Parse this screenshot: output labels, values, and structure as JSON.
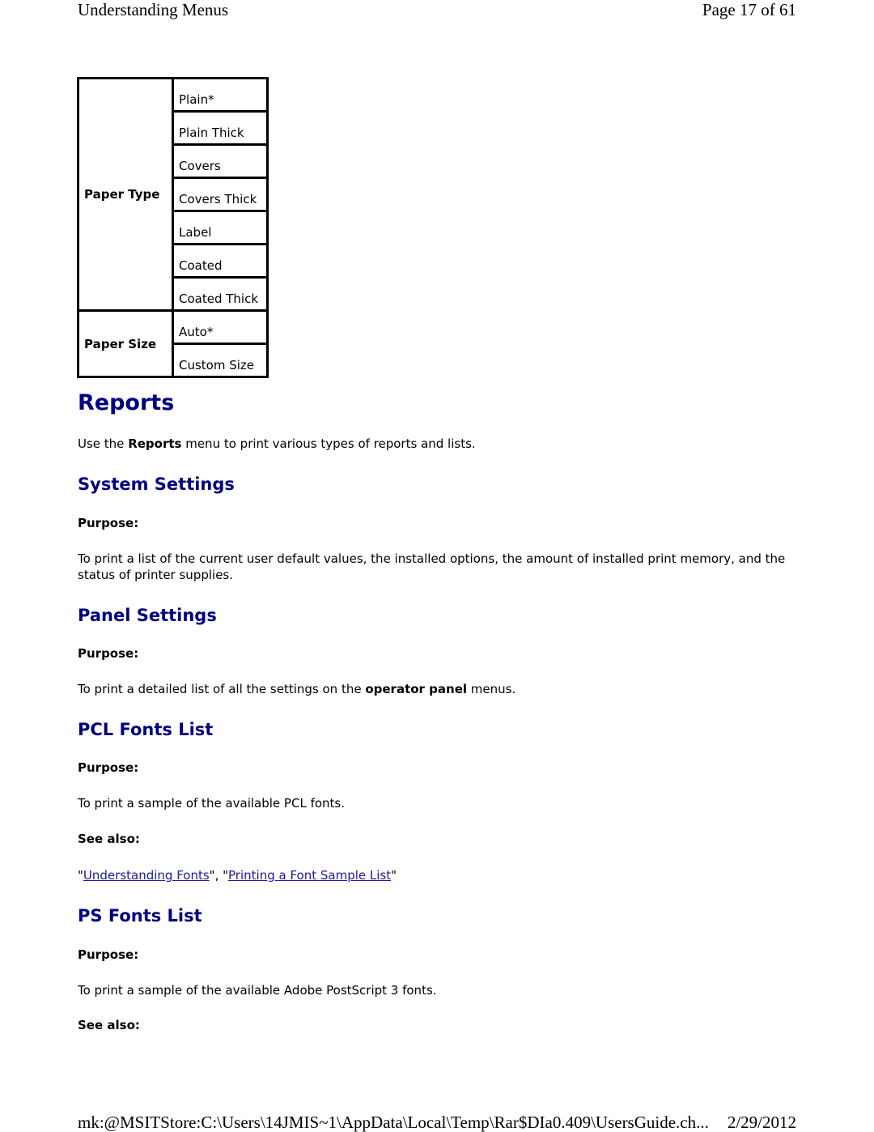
{
  "header": {
    "title": "Understanding Menus",
    "page": "Page 17 of 61"
  },
  "table": {
    "rows": [
      {
        "label": "Paper Type",
        "values": [
          "Plain*",
          "Plain Thick",
          "Covers",
          "Covers Thick",
          "Label",
          "Coated",
          "Coated Thick"
        ]
      },
      {
        "label": "Paper Size",
        "values": [
          "Auto*",
          "Custom Size"
        ]
      }
    ]
  },
  "reports": {
    "title": "Reports",
    "intro_pre": "Use the ",
    "intro_bold": "Reports",
    "intro_post": " menu to print various types of reports and lists."
  },
  "sections": {
    "system_settings": {
      "title": "System Settings",
      "purpose_label": "Purpose:",
      "purpose_text": "To print a list of the current user default values, the installed options, the amount of installed print memory, and the status of printer supplies."
    },
    "panel_settings": {
      "title": "Panel Settings",
      "purpose_label": "Purpose:",
      "purpose_pre": "To print a detailed list of all the settings on the ",
      "purpose_bold": "operator panel",
      "purpose_post": " menus."
    },
    "pcl_fonts": {
      "title": "PCL Fonts List",
      "purpose_label": "Purpose:",
      "purpose_text": "To print a sample of the available PCL fonts.",
      "see_also_label": "See also:",
      "see_also_links": [
        "Understanding Fonts",
        "Printing a Font Sample List"
      ]
    },
    "ps_fonts": {
      "title": "PS Fonts List",
      "purpose_label": "Purpose:",
      "purpose_text": "To print a sample of the available Adobe PostScript 3 fonts.",
      "see_also_label": "See also:"
    }
  },
  "footer": {
    "path": "mk:@MSITStore:C:\\Users\\14JMIS~1\\AppData\\Local\\Temp\\Rar$DIa0.409\\UsersGuide.ch...",
    "date": "2/29/2012"
  }
}
